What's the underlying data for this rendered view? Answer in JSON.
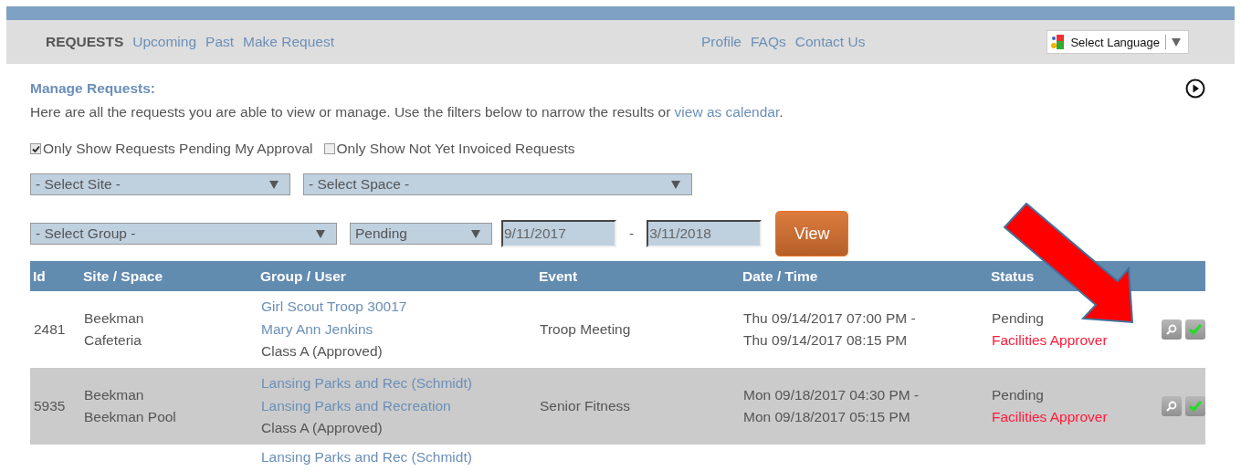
{
  "nav": {
    "title": "REQUESTS",
    "left_links": [
      "Upcoming",
      "Past",
      "Make Request"
    ],
    "right_links": [
      "Profile",
      "FAQs",
      "Contact Us"
    ],
    "language": "Select Language"
  },
  "heading": "Manage Requests:",
  "intro": {
    "text": "Here are all the requests you are able to view or manage. Use the filters below to narrow the results or ",
    "link": "view as calendar",
    "end": "."
  },
  "filters": {
    "checkboxes": [
      {
        "label": "Only Show Requests Pending My Approval",
        "checked": true
      },
      {
        "label": "Only Show Not Yet Invoiced Requests",
        "checked": false
      }
    ],
    "site": "- Select Site -",
    "space": "- Select Space -",
    "group": "- Select Group -",
    "status": "Pending",
    "date_from": "9/11/2017",
    "date_separator": "-",
    "date_to": "3/11/2018",
    "view_button": "View"
  },
  "table": {
    "columns": [
      "Id",
      "Site / Space",
      "Group / User",
      "Event",
      "Date / Time",
      "Status"
    ],
    "rows": [
      {
        "id": "2481",
        "site": [
          "Beekman",
          "Cafeteria"
        ],
        "group_links": [
          "Girl Scout Troop 30017",
          "Mary Ann Jenkins"
        ],
        "class": "Class A (Approved)",
        "event": "Troop Meeting",
        "datetime": [
          "Thu 09/14/2017 07:00 PM -",
          "Thu 09/14/2017 08:15 PM"
        ],
        "status": "Pending",
        "approver": "Facilities Approver"
      },
      {
        "id": "5935",
        "site": [
          "Beekman",
          "Beekman Pool"
        ],
        "group_links": [
          "Lansing Parks and Rec (Schmidt)",
          "Lansing Parks and Recreation"
        ],
        "class": "Class A (Approved)",
        "event": "Senior Fitness",
        "datetime": [
          "Mon 09/18/2017 04:30 PM -",
          "Mon 09/18/2017 05:15 PM"
        ],
        "status": "Pending",
        "approver": "Facilities Approver"
      },
      {
        "group_links": [
          "Lansing Parks and Rec (Schmidt)"
        ]
      }
    ]
  }
}
